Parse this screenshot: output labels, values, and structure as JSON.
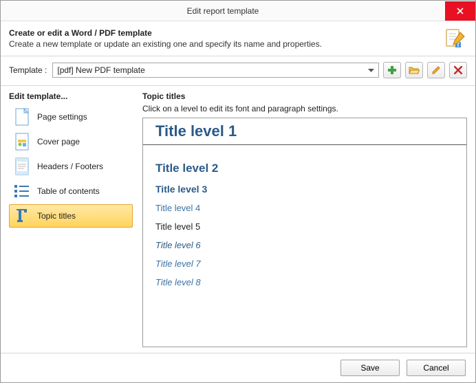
{
  "window": {
    "title": "Edit report template"
  },
  "header": {
    "title": "Create or edit a Word / PDF template",
    "subtitle": "Create a new template or update an existing one and specify its name and properties."
  },
  "template": {
    "label": "Template :",
    "selected": "[pdf] New PDF template"
  },
  "sidebar": {
    "title": "Edit template...",
    "items": [
      {
        "label": "Page settings"
      },
      {
        "label": "Cover page"
      },
      {
        "label": "Headers / Footers"
      },
      {
        "label": "Table of contents"
      },
      {
        "label": "Topic titles"
      }
    ],
    "selected_index": 4
  },
  "main": {
    "title": "Topic titles",
    "subtitle": "Click on a level to edit its font and paragraph settings.",
    "levels": [
      "Title level 1",
      "Title level 2",
      "Title level 3",
      "Title level 4",
      "Title level 5",
      "Title level 6",
      "Title level 7",
      "Title level 8"
    ]
  },
  "footer": {
    "save": "Save",
    "cancel": "Cancel"
  }
}
